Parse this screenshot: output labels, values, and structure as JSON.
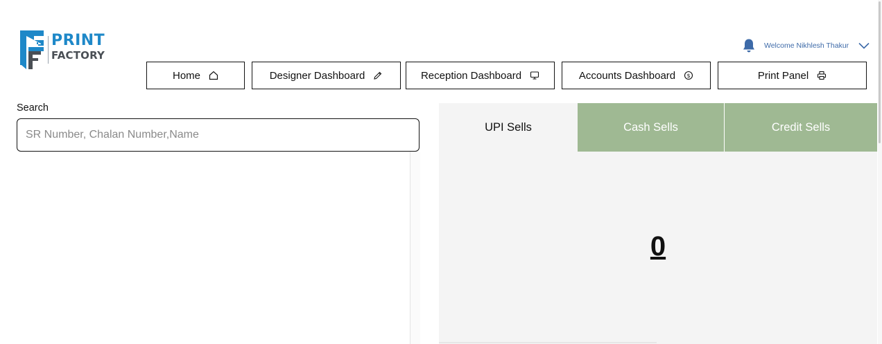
{
  "brand": {
    "logo_word_top": "PRINT",
    "logo_word_bottom": "FACTORY",
    "primary_color": "#1e88c8",
    "secondary_color": "#4a4f55"
  },
  "user": {
    "welcome_text": "Welcome Nikhlesh Thakur",
    "bell_icon": "bell-icon",
    "menu_icon": "chevron-down-icon",
    "accent_color": "#3d6aa8"
  },
  "nav": {
    "items": [
      {
        "label": "Home",
        "icon": "home-icon"
      },
      {
        "label": "Designer Dashboard",
        "icon": "pencil-icon"
      },
      {
        "label": "Reception Dashboard",
        "icon": "monitor-icon"
      },
      {
        "label": "Accounts Dashboard",
        "icon": "dollar-coin-icon"
      },
      {
        "label": "Print Panel",
        "icon": "printer-icon"
      }
    ]
  },
  "search": {
    "label": "Search",
    "placeholder": "SR Number, Chalan Number,Name",
    "value": ""
  },
  "sales": {
    "tabs": [
      {
        "label": "UPI Sells",
        "active": true
      },
      {
        "label": "Cash Sells",
        "active": false
      },
      {
        "label": "Credit Sells",
        "active": false
      }
    ],
    "value": "0",
    "tab_inactive_color": "#9fb993",
    "panel_color": "#f4f4f4"
  }
}
